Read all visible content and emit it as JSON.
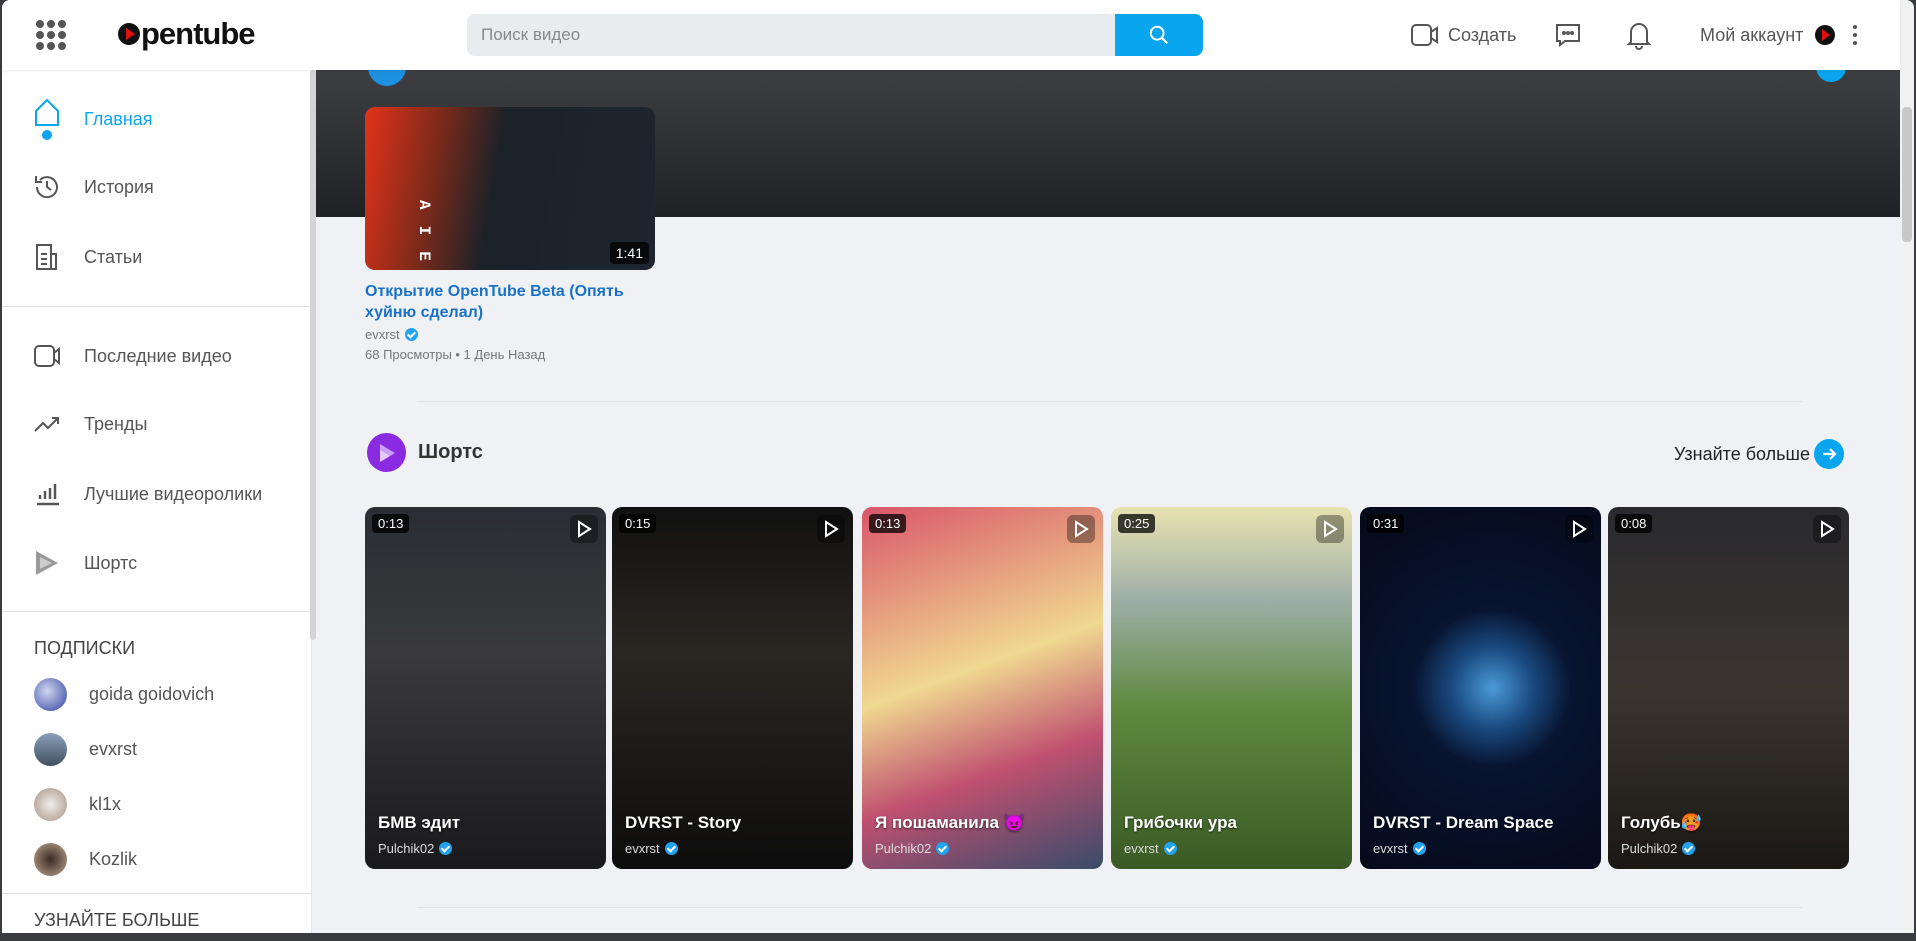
{
  "header": {
    "logo": "opentube",
    "search_placeholder": "Поиск видео",
    "create_label": "Создать",
    "account_label": "Мой аккаунт"
  },
  "sidebar": {
    "main": [
      {
        "label": "Главная",
        "icon": "home-icon",
        "active": true
      },
      {
        "label": "История",
        "icon": "history-icon"
      },
      {
        "label": "Статьи",
        "icon": "articles-icon"
      }
    ],
    "explore": [
      {
        "label": "Последние видео",
        "icon": "video-camera-icon"
      },
      {
        "label": "Тренды",
        "icon": "trending-icon"
      },
      {
        "label": "Лучшие видеоролики",
        "icon": "bar-chart-icon"
      },
      {
        "label": "Шортс",
        "icon": "shorts-icon"
      }
    ],
    "subscriptions_title": "ПОДПИСКИ",
    "subscriptions": [
      {
        "name": "goida goidovich"
      },
      {
        "name": "evxrst"
      },
      {
        "name": "kl1x"
      },
      {
        "name": "Kozlik"
      }
    ],
    "more_title": "УЗНАЙТЕ БОЛЬШЕ"
  },
  "video": {
    "title": "Открытие OpenTube Beta (Опять хуйню сделал)",
    "channel": "evxrst",
    "stats": "68 Просмотры • 1 День Назад",
    "duration": "1:41"
  },
  "shorts": {
    "title": "Шортс",
    "more_label": "Узнайте больше",
    "items": [
      {
        "title": "БМВ эдит",
        "channel": "Pulchik02",
        "duration": "0:13"
      },
      {
        "title": "DVRST - Story",
        "channel": "evxrst",
        "duration": "0:15"
      },
      {
        "title": "Я пошаманила 😈",
        "channel": "Pulchik02",
        "duration": "0:13"
      },
      {
        "title": "Грибочки ура",
        "channel": "evxrst",
        "duration": "0:25"
      },
      {
        "title": "DVRST - Dream Space",
        "channel": "evxrst",
        "duration": "0:31"
      },
      {
        "title": "Голубь🥵",
        "channel": "Pulchik02",
        "duration": "0:08"
      }
    ]
  }
}
